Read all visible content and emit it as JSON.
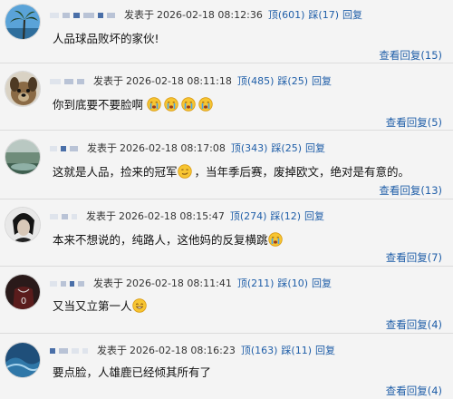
{
  "comments": [
    {
      "posted_label": "发表于",
      "timestamp": "2026-02-18 08:12:36",
      "up_label": "顶",
      "up_count": "(601)",
      "down_label": "踩",
      "down_count": "(17)",
      "reply_label": "回复",
      "text": "人品球品败坏的家伙!",
      "view_replies": "查看回复(15)",
      "avatar_icon": "palm-tree-avatar-icon"
    },
    {
      "posted_label": "发表于",
      "timestamp": "2026-02-18 08:11:18",
      "up_label": "顶",
      "up_count": "(485)",
      "down_label": "踩",
      "down_count": "(25)",
      "reply_label": "回复",
      "text": "你到底要不要脸啊",
      "view_replies": "查看回复(5)",
      "avatar_icon": "dog-avatar-icon",
      "emoji": "crying-face-emoji"
    },
    {
      "posted_label": "发表于",
      "timestamp": "2026-02-18 08:17:08",
      "up_label": "顶",
      "up_count": "(343)",
      "down_label": "踩",
      "down_count": "(25)",
      "reply_label": "回复",
      "text_before": "这就是人品，捡来的冠军",
      "text_after": "，当年季后赛，废掉欧文，绝对是有意的。",
      "view_replies": "查看回复(13)",
      "avatar_icon": "landscape-avatar-icon",
      "emoji": "smirk-face-emoji"
    },
    {
      "posted_label": "发表于",
      "timestamp": "2026-02-18 08:15:47",
      "up_label": "顶",
      "up_count": "(274)",
      "down_label": "踩",
      "down_count": "(12)",
      "reply_label": "回复",
      "text": "本来不想说的，纯路人，这他妈的反复横跳",
      "view_replies": "查看回复(7)",
      "avatar_icon": "portrait-avatar-icon",
      "emoji": "crying-face-emoji"
    },
    {
      "posted_label": "发表于",
      "timestamp": "2026-02-18 08:11:41",
      "up_label": "顶",
      "up_count": "(211)",
      "down_label": "踩",
      "down_count": "(10)",
      "reply_label": "回复",
      "text": "又当又立第一人",
      "view_replies": "查看回复(4)",
      "avatar_icon": "jersey-avatar-icon",
      "emoji": "grinning-face-emoji"
    },
    {
      "posted_label": "发表于",
      "timestamp": "2026-02-18 08:16:23",
      "up_label": "顶",
      "up_count": "(163)",
      "down_label": "踩",
      "down_count": "(11)",
      "reply_label": "回复",
      "text": "要点脸，人雄鹿已经倾其所有了",
      "view_replies": "查看回复(4)",
      "avatar_icon": "ocean-avatar-icon"
    }
  ]
}
